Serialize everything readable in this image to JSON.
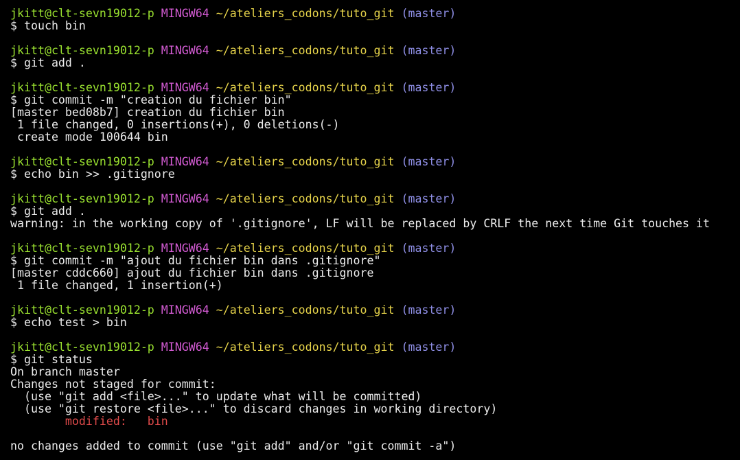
{
  "colors": {
    "background": "#000000",
    "text": "#ececec",
    "user_host": "#9be330",
    "mingw": "#d35bd3",
    "path": "#e6d34a",
    "branch": "#8f8fe6",
    "modified": "#e14b4b"
  },
  "prompt": {
    "user_host": "jkitt@clt-sevn19012-p",
    "system": "MINGW64",
    "path": "~/ateliers_codons/tuto_git",
    "branch": "(master)"
  },
  "lines": [
    {
      "kind": "prompt"
    },
    {
      "kind": "text",
      "text": "$ touch bin"
    },
    {
      "kind": "blank"
    },
    {
      "kind": "prompt"
    },
    {
      "kind": "text",
      "text": "$ git add ."
    },
    {
      "kind": "blank"
    },
    {
      "kind": "prompt"
    },
    {
      "kind": "text",
      "text": "$ git commit -m \"creation du fichier bin\""
    },
    {
      "kind": "text",
      "text": "[master bed08b7] creation du fichier bin"
    },
    {
      "kind": "text",
      "text": " 1 file changed, 0 insertions(+), 0 deletions(-)"
    },
    {
      "kind": "text",
      "text": " create mode 100644 bin"
    },
    {
      "kind": "blank"
    },
    {
      "kind": "prompt"
    },
    {
      "kind": "text",
      "text": "$ echo bin >> .gitignore"
    },
    {
      "kind": "blank"
    },
    {
      "kind": "prompt"
    },
    {
      "kind": "text",
      "text": "$ git add ."
    },
    {
      "kind": "text",
      "text": "warning: in the working copy of '.gitignore', LF will be replaced by CRLF the next time Git touches it"
    },
    {
      "kind": "blank"
    },
    {
      "kind": "prompt"
    },
    {
      "kind": "text",
      "text": "$ git commit -m \"ajout du fichier bin dans .gitignore\""
    },
    {
      "kind": "text",
      "text": "[master cddc660] ajout du fichier bin dans .gitignore"
    },
    {
      "kind": "text",
      "text": " 1 file changed, 1 insertion(+)"
    },
    {
      "kind": "blank"
    },
    {
      "kind": "prompt"
    },
    {
      "kind": "text",
      "text": "$ echo test > bin"
    },
    {
      "kind": "blank"
    },
    {
      "kind": "prompt"
    },
    {
      "kind": "text",
      "text": "$ git status"
    },
    {
      "kind": "text",
      "text": "On branch master"
    },
    {
      "kind": "text",
      "text": "Changes not staged for commit:"
    },
    {
      "kind": "text",
      "text": "  (use \"git add <file>...\" to update what will be committed)"
    },
    {
      "kind": "text",
      "text": "  (use \"git restore <file>...\" to discard changes in working directory)"
    },
    {
      "kind": "modified",
      "text": "        modified:   bin"
    },
    {
      "kind": "blank"
    },
    {
      "kind": "text",
      "text": "no changes added to commit (use \"git add\" and/or \"git commit -a\")"
    }
  ]
}
